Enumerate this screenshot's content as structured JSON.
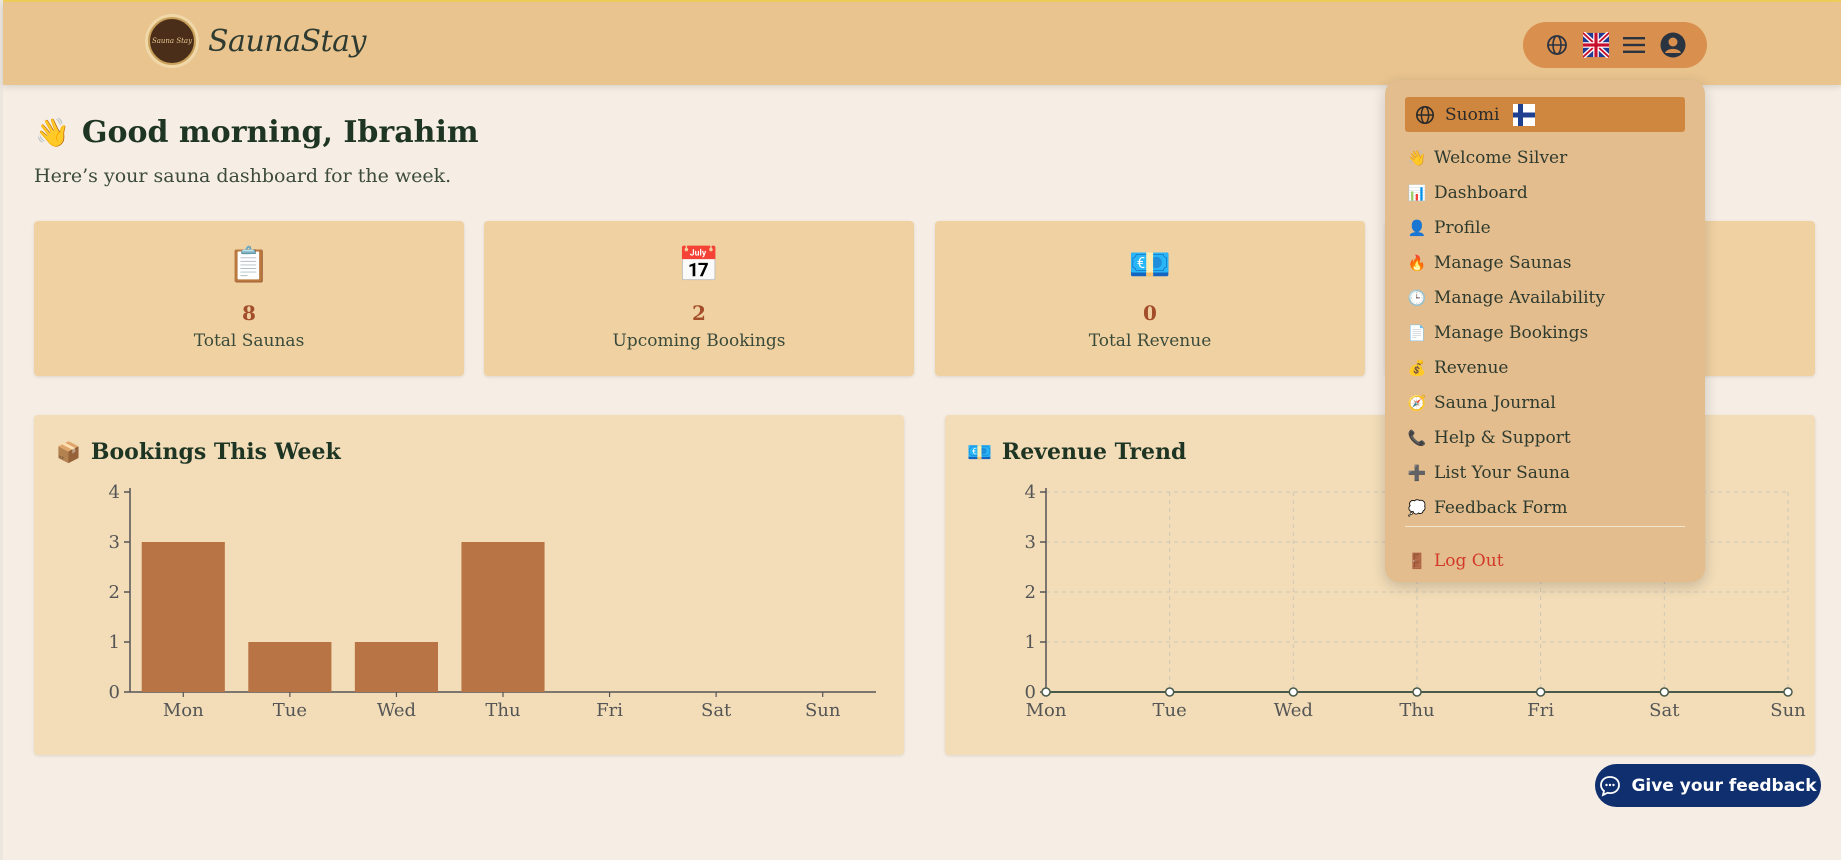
{
  "header": {
    "brand": "SaunaStay",
    "logo_text": "Sauna Stay"
  },
  "greeting": {
    "emoji": "👋",
    "title": "Good morning, Ibrahim",
    "subtitle": "Here’s your sauna dashboard for the week."
  },
  "stats": [
    {
      "emoji": "📋",
      "value": "8",
      "label": "Total Saunas"
    },
    {
      "emoji": "📅",
      "value": "2",
      "label": "Upcoming Bookings"
    },
    {
      "emoji": "💶",
      "value": "0",
      "label": "Total Revenue"
    }
  ],
  "panels": {
    "bookings": {
      "icon": "📦",
      "title": "Bookings This Week"
    },
    "revenue": {
      "icon": "💶",
      "title": "Revenue Trend"
    }
  },
  "chart_data": [
    {
      "type": "bar",
      "title": "Bookings This Week",
      "categories": [
        "Mon",
        "Tue",
        "Wed",
        "Thu",
        "Fri",
        "Sat",
        "Sun"
      ],
      "values": [
        3,
        1,
        1,
        3,
        0,
        0,
        0
      ],
      "ylim": [
        0,
        4
      ],
      "yticks": [
        0,
        1,
        2,
        3,
        4
      ],
      "color": "#b87444",
      "grid": false
    },
    {
      "type": "line",
      "title": "Revenue Trend",
      "categories": [
        "Mon",
        "Tue",
        "Wed",
        "Thu",
        "Fri",
        "Sat",
        "Sun"
      ],
      "values": [
        0,
        0,
        0,
        0,
        0,
        0,
        0
      ],
      "ylim": [
        0,
        4
      ],
      "yticks": [
        0,
        1,
        2,
        3,
        4
      ],
      "color": "#4a5a4a",
      "grid": true
    }
  ],
  "menu": {
    "language": "Suomi",
    "items": [
      {
        "icon": "👋",
        "label": "Welcome Silver"
      },
      {
        "icon": "📊",
        "label": "Dashboard"
      },
      {
        "icon": "👤",
        "label": "Profile"
      },
      {
        "icon": "🔥",
        "label": "Manage Saunas"
      },
      {
        "icon": "🕒",
        "label": "Manage Availability"
      },
      {
        "icon": "📄",
        "label": "Manage Bookings"
      },
      {
        "icon": "💰",
        "label": "Revenue"
      },
      {
        "icon": "🧭",
        "label": "Sauna Journal"
      },
      {
        "icon": "📞",
        "label": "Help & Support"
      },
      {
        "icon": "➕",
        "label": "List Your Sauna"
      },
      {
        "icon": "💭",
        "label": "Feedback Form"
      }
    ],
    "logout_icon": "🚪",
    "logout": "Log Out"
  },
  "feedback_button": "Give your feedback",
  "colors": {
    "header": "#e9c48f",
    "accent": "#d98f4e",
    "bar": "#b87444",
    "feedback": "#0f2f6e",
    "logout": "#d23a2a"
  }
}
